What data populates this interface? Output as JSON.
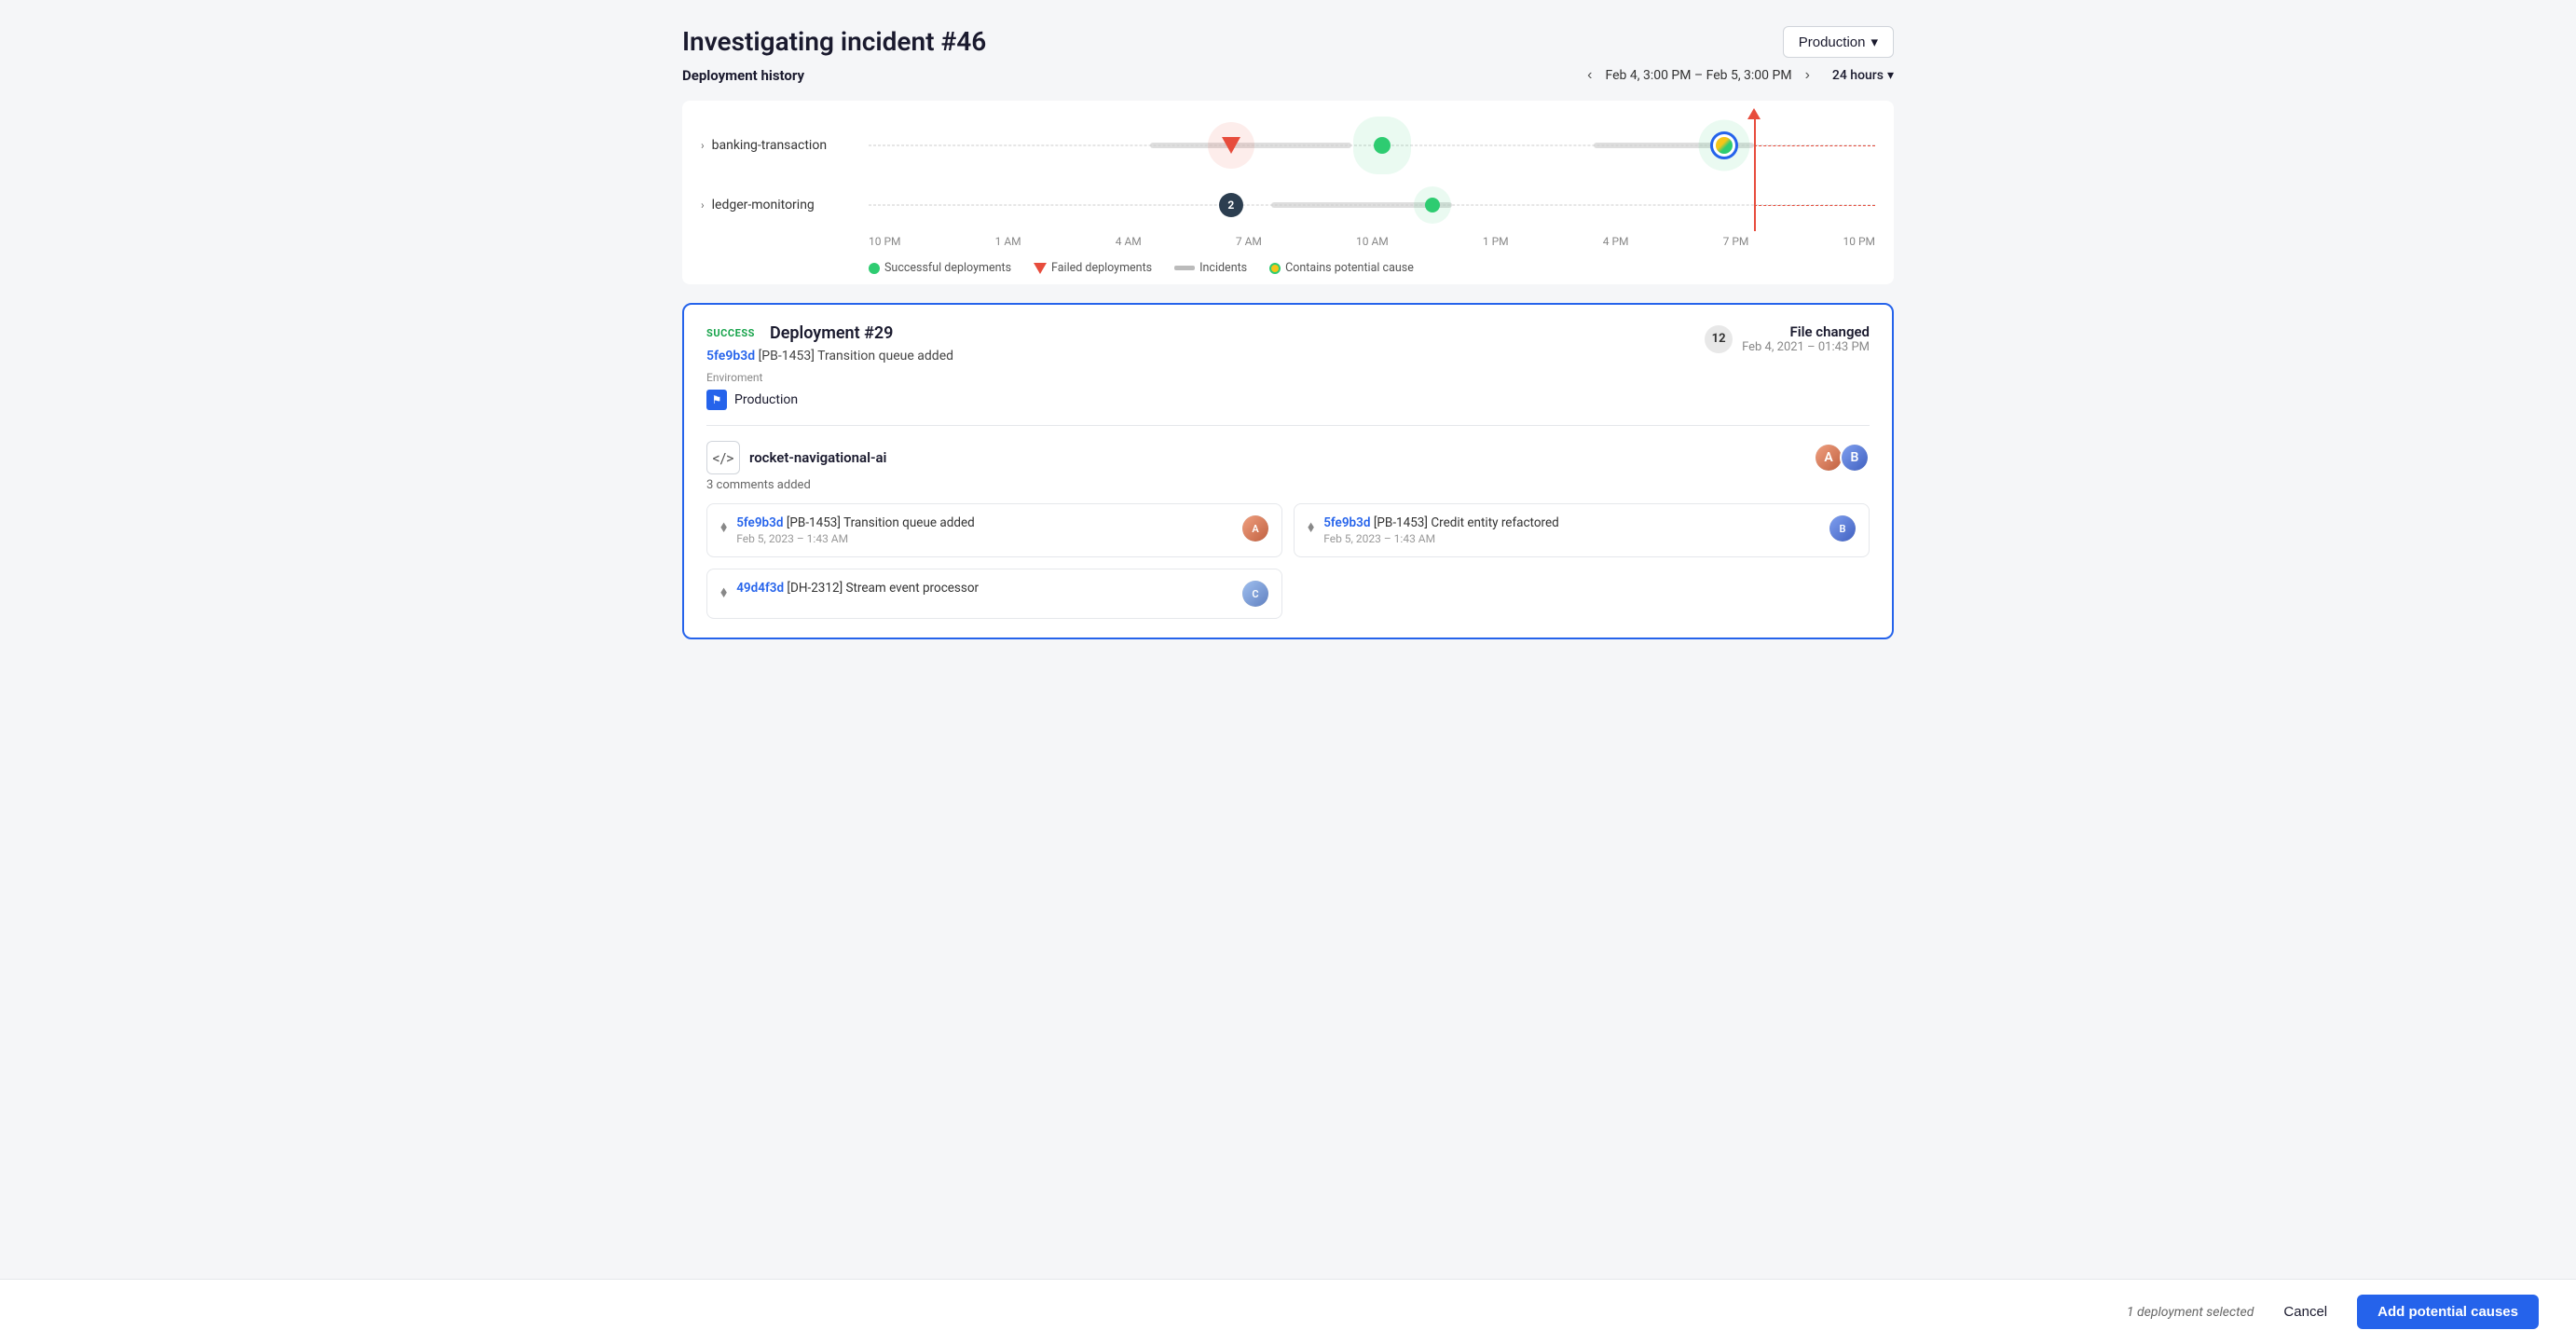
{
  "page": {
    "title": "Investigating incident #46"
  },
  "environment_dropdown": {
    "label": "Production",
    "chevron": "▾"
  },
  "deployment_history": {
    "section_title": "Deployment history",
    "date_range": "Feb 4, 3:00 PM – Feb 5, 3:00 PM",
    "hours_label": "24 hours",
    "hours_chevron": "▾",
    "x_axis_labels": [
      "10 PM",
      "1 AM",
      "4 AM",
      "7 AM",
      "10 AM",
      "1 PM",
      "4 PM",
      "7 PM",
      "10 PM"
    ],
    "rows": [
      {
        "id": "banking-transaction",
        "label": "banking-transaction"
      },
      {
        "id": "ledger-monitoring",
        "label": "ledger-monitoring"
      }
    ],
    "legend": {
      "successful": "Successful deployments",
      "failed": "Failed deployments",
      "incidents": "Incidents",
      "potential": "Contains potential cause"
    }
  },
  "deployment_card": {
    "status": "SUCCESS",
    "title": "Deployment #29",
    "commit_short": "5fe9b3d",
    "commit_message": "[PB-1453] Transition queue added",
    "environment_label": "Enviroment",
    "environment_value": "Production",
    "file_count": "12",
    "file_changed_label": "File changed",
    "file_date": "Feb 4, 2021 – 01:43 PM",
    "repo_name": "rocket-navigational-ai",
    "comments_label": "3 comments added",
    "commits": [
      {
        "hash": "5fe9b3d",
        "message": "[PB-1453] Transition queue added",
        "time": "Feb 5, 2023 – 1:43 AM",
        "avatar_initial": "A"
      },
      {
        "hash": "5fe9b3d",
        "message": "[PB-1453] Credit entity refactored",
        "time": "Feb 5, 2023 – 1:43 AM",
        "avatar_initial": "B"
      },
      {
        "hash": "49d4f3d",
        "message": "[DH-2312] Stream event processor",
        "time": "",
        "avatar_initial": "C"
      }
    ]
  },
  "bottom_bar": {
    "selected_text": "1 deployment selected",
    "cancel_label": "Cancel",
    "add_causes_label": "Add potential causes"
  }
}
